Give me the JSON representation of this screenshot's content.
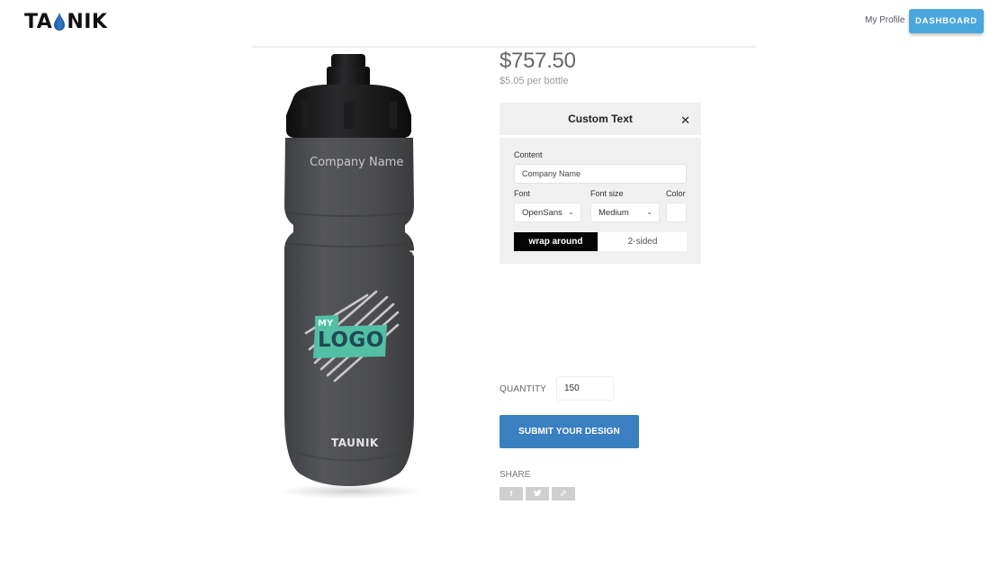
{
  "header": {
    "brand": {
      "prefix": "TA",
      "suffix": "NIK",
      "drop_color": "#1f5fa8"
    },
    "nav": {
      "profile_label": "My Profile",
      "dashboard_label": "DASHBOARD"
    },
    "colors": {
      "dashboard_bg": "#4aa7dd"
    }
  },
  "product": {
    "bottle": {
      "body_color": "#4a4b4d",
      "cap_color": "#141414",
      "text_line": "Company Name",
      "logo": {
        "small": "MY",
        "big": "LOGO",
        "badge_color": "#53bfa4",
        "text_color": "#1e4a55"
      },
      "brand_mark": "TAUNIK"
    },
    "price": "$757.50",
    "unit_price": "$5.05 per bottle"
  },
  "custom_text_panel": {
    "title": "Custom Text",
    "close_icon": "close-icon",
    "content_label": "Content",
    "content_value": "Company Name",
    "font_label": "Font",
    "font_value": "OpenSans",
    "font_size_label": "Font size",
    "font_size_value": "Medium",
    "color_label": "Color",
    "color_value": "#ffffff",
    "mode_options": [
      {
        "label": "wrap around",
        "active": true
      },
      {
        "label": "2-sided",
        "active": false
      }
    ]
  },
  "order": {
    "quantity_label": "QUANTITY",
    "quantity_value": "150",
    "submit_label": "SUBMIT YOUR DESIGN",
    "submit_color": "#3a7fc0"
  },
  "share": {
    "label": "SHARE",
    "buttons": [
      {
        "icon": "facebook-icon",
        "glyph": "f"
      },
      {
        "icon": "twitter-icon",
        "glyph": "🐦"
      },
      {
        "icon": "link-icon",
        "glyph": "🔗"
      }
    ]
  }
}
